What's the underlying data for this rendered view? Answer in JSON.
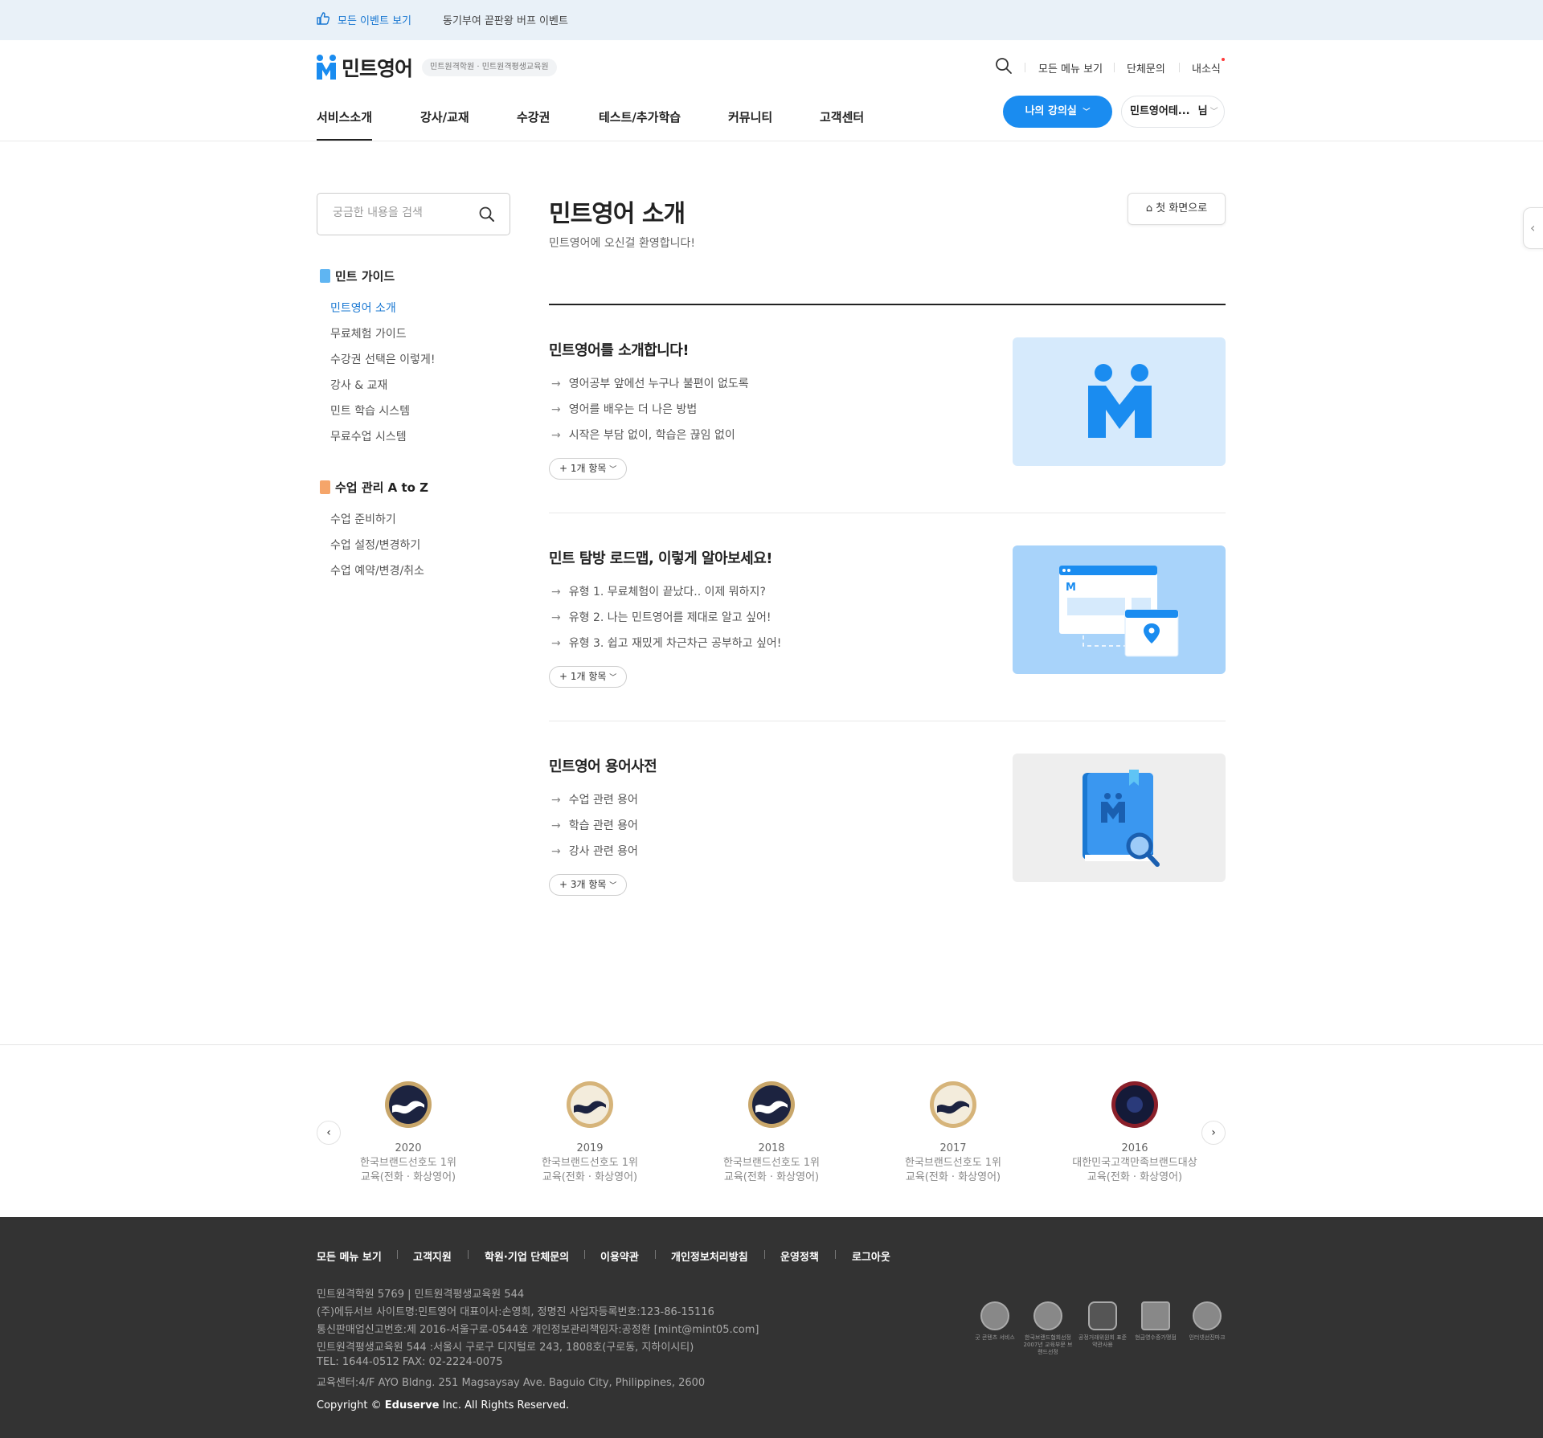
{
  "eventbar": {
    "all_events": "모든 이벤트 보기",
    "promo": "동기부여 끝판왕 버프 이벤트"
  },
  "header": {
    "logo_text": "민트영어",
    "logo_badge": "민트원격학원 · 민트원격평생교육원",
    "links": [
      "모든 메뉴 보기",
      "단체문의",
      "내소식"
    ],
    "nav": [
      "서비스소개",
      "강사/교재",
      "수강권",
      "테스트/추가학습",
      "커뮤니티",
      "고객센터"
    ],
    "my_lecture": "나의 강의실",
    "user_name": "민트영어테...",
    "user_suffix": "님"
  },
  "sidebar": {
    "search_placeholder": "궁금한 내용을 검색",
    "groups": [
      {
        "title": "민트 가이드",
        "items": [
          "민트영어 소개",
          "무료체험 가이드",
          "수강권 선택은 이렇게!",
          "강사 & 교재",
          "민트 학습 시스템",
          "무료수업 시스템"
        ]
      },
      {
        "title": "수업 관리 A to Z",
        "items": [
          "수업 준비하기",
          "수업 설정/변경하기",
          "수업 예약/변경/취소"
        ]
      }
    ]
  },
  "main": {
    "title": "민트영어 소개",
    "subtitle": "민트영어에 오신걸 환영합니다!",
    "home_button": "첫 화면으로",
    "cards": [
      {
        "title": "민트영어를 소개합니다!",
        "items": [
          "영어공부 앞에선 누구나 불편이 없도록",
          "영어를 배우는 더 나은 방법",
          "시작은 부담 없이, 학습은 끊임 없이"
        ],
        "more": "1개 항목"
      },
      {
        "title": "민트 탐방 로드맵, 이렇게 알아보세요!",
        "items": [
          "유형 1. 무료체험이 끝났다.. 이제 뭐하지?",
          "유형 2. 나는 민트영어를 제대로 알고 싶어!",
          "유형 3. 쉽고 재밌게 차근차근 공부하고 싶어!"
        ],
        "more": "1개 항목"
      },
      {
        "title": "민트영어 용어사전",
        "items": [
          "수업 관련 용어",
          "학습 관련 용어",
          "강사 관련 용어"
        ],
        "more": "3개 항목"
      }
    ]
  },
  "awards": [
    {
      "year": "2020",
      "line1": "한국브랜드선호도 1위",
      "line2": "교육(전화 · 화상영어)"
    },
    {
      "year": "2019",
      "line1": "한국브랜드선호도 1위",
      "line2": "교육(전화 · 화상영어)"
    },
    {
      "year": "2018",
      "line1": "한국브랜드선호도 1위",
      "line2": "교육(전화 · 화상영어)"
    },
    {
      "year": "2017",
      "line1": "한국브랜드선호도 1위",
      "line2": "교육(전화 · 화상영어)"
    },
    {
      "year": "2016",
      "line1": "대한민국고객만족브랜드대상",
      "line2": "교육(전화 · 화상영어)"
    }
  ],
  "footer": {
    "links": [
      "모든 메뉴 보기",
      "고객지원",
      "학원·기업 단체문의",
      "이용약관",
      "개인정보처리방침",
      "운영정책",
      "로그아웃"
    ],
    "info": [
      "민트원격학원 5769 | 민트원격평생교육원 544",
      "(주)에듀서브  사이트명:민트영어  대표이사:손영희, 정명진  사업자등록번호:123-86-15116",
      "통신판매업신고번호:제 2016-서울구로-0544호  개인정보관리책임자:공정환 [mint@mint05.com]",
      "민트원격평생교육원 544 :서울시 구로구 디지털로 243, 1808호(구로동, 지하이시티)",
      "TEL: 1644-0512 FAX: 02-2224-0075",
      "교육센터:4/F AYO Bldng. 251 Magsaysay Ave. Baguio City, Philippines, 2600"
    ],
    "copyright_prefix": "Copyright ©",
    "copyright_company": "Eduserve",
    "copyright_suffix": "Inc. All Rights Reserved.",
    "certs": [
      "굿 콘텐츠 서비스",
      "한국브랜드협회선정 2007년 교육부문 브랜드선정",
      "공정거래위원회 표준약관사용",
      "현금영수증가맹점",
      "인터넷선진마크"
    ]
  },
  "colors": {
    "accent": "#1a8cf0",
    "footer_bg": "#333333",
    "eventbar_bg": "#e9f1f8",
    "card1_bg": "#d6eafc",
    "card2_bg": "#a8d3fa",
    "card3_bg": "#eeeeee"
  }
}
